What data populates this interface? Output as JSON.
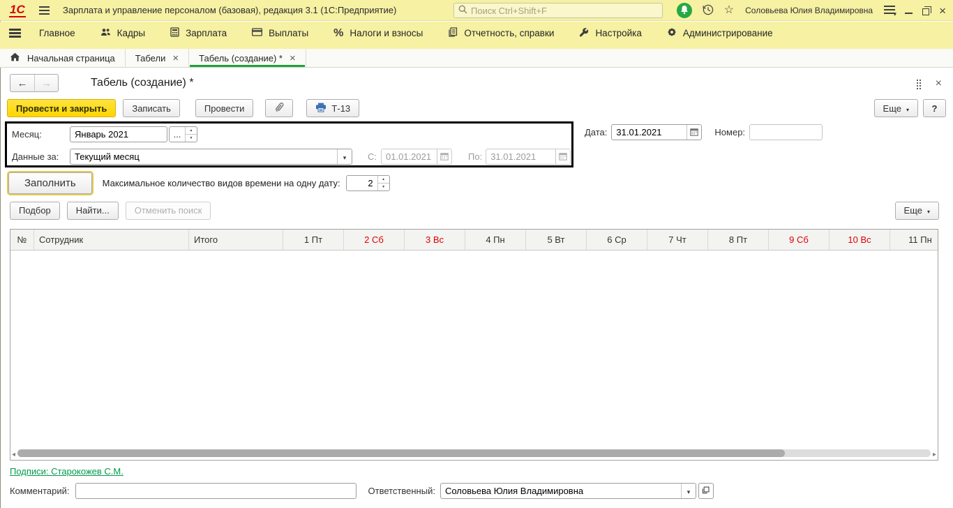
{
  "window": {
    "app_title": "Зарплата и управление персоналом (базовая), редакция 3.1 (1С:Предприятие)",
    "logo_text": "1С",
    "search_placeholder": "Поиск Ctrl+Shift+F",
    "user_name": "Соловьева Юлия Владимировна"
  },
  "menu": {
    "items": [
      {
        "label": "Главное"
      },
      {
        "label": "Кадры"
      },
      {
        "label": "Зарплата"
      },
      {
        "label": "Выплаты"
      },
      {
        "label": "Налоги и взносы"
      },
      {
        "label": "Отчетность, справки"
      },
      {
        "label": "Настройка"
      },
      {
        "label": "Администрирование"
      }
    ]
  },
  "tabs": {
    "home": {
      "label": "Начальная страница"
    },
    "tabeli": {
      "label": "Табели"
    },
    "tabel": {
      "label": "Табель (создание) *"
    }
  },
  "doc": {
    "title": "Табель (создание) *",
    "toolbar": {
      "post_and_close": "Провести и закрыть",
      "save": "Записать",
      "post": "Провести",
      "print": "Т-13",
      "more": "Еще",
      "help": "?"
    },
    "fields": {
      "month_label": "Месяц:",
      "month_value": "Январь 2021",
      "month_more": "...",
      "period_label": "Данные за:",
      "period_value": "Текущий месяц",
      "from_label": "С:",
      "from_value": "01.01.2021",
      "to_label": "По:",
      "to_value": "31.01.2021",
      "date_label": "Дата:",
      "date_value": "31.01.2021",
      "number_label": "Номер:",
      "number_value": ""
    },
    "fill": {
      "button": "Заполнить",
      "max_label": "Максимальное количество видов времени на одну дату:",
      "max_value": "2"
    },
    "list_toolbar": {
      "pick": "Подбор",
      "find": "Найти...",
      "cancel_search": "Отменить поиск",
      "more": "Еще"
    },
    "table": {
      "columns": [
        {
          "label": "№",
          "weekend": false
        },
        {
          "label": "Сотрудник",
          "weekend": false
        },
        {
          "label": "Итого",
          "weekend": false
        },
        {
          "label": "1 Пт",
          "weekend": false
        },
        {
          "label": "2 Сб",
          "weekend": true
        },
        {
          "label": "3 Вс",
          "weekend": true
        },
        {
          "label": "4 Пн",
          "weekend": false
        },
        {
          "label": "5 Вт",
          "weekend": false
        },
        {
          "label": "6 Ср",
          "weekend": false
        },
        {
          "label": "7 Чт",
          "weekend": false
        },
        {
          "label": "8 Пт",
          "weekend": false
        },
        {
          "label": "9 Сб",
          "weekend": true
        },
        {
          "label": "10 Вс",
          "weekend": true
        },
        {
          "label": "11 Пн",
          "weekend": false
        }
      ]
    },
    "footer": {
      "signatures": "Подписи: Старокожев С.М.",
      "comment_label": "Комментарий:",
      "comment_value": "",
      "responsible_label": "Ответственный:",
      "responsible_value": "Соловьева Юлия Владимировна"
    }
  },
  "colors": {
    "titlebar_bg": "#F6F1A3",
    "accent_green": "#1FA23D",
    "weekend_red": "#DF0000",
    "primary_button_yellow": "#FFD600",
    "link_green": "#00994C"
  }
}
